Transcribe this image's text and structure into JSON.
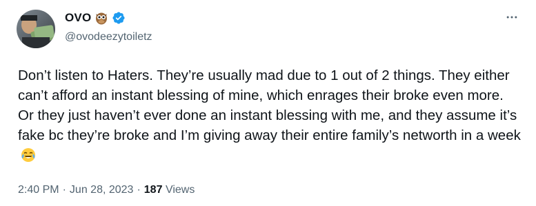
{
  "author": {
    "display_name": "OVO",
    "handle": "@ovodeezytoiletz",
    "name_emoji": "owl-emoji",
    "verified": true,
    "verified_color": "#1d9bf0"
  },
  "tweet": {
    "text": "Don’t listen to Haters. They’re usually mad due to 1 out of 2 things. They either can’t afford an instant blessing of mine, which enrages their broke even more. Or they just haven’t ever done an instant blessing with me, and they assume it’s fake bc they’re broke and I’m giving away their entire family’s networth in a week",
    "trailing_emoji": "face-with-tears-of-joy-emoji"
  },
  "meta": {
    "time": "2:40 PM",
    "separator": "·",
    "date": "Jun 28, 2023",
    "views_count": "187",
    "views_label": "Views"
  },
  "icons": {
    "more": "more-horizontal-icon"
  }
}
